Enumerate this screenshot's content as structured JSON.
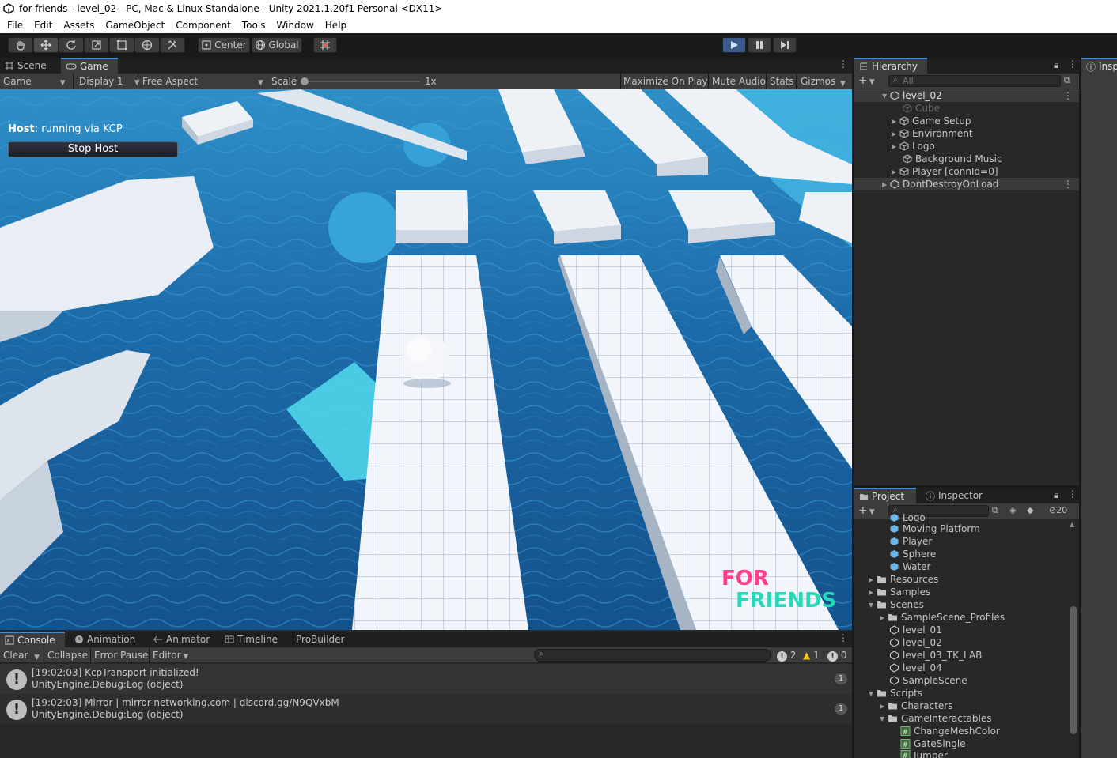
{
  "window": {
    "title": "for-friends - level_02 - PC, Mac & Linux Standalone - Unity 2021.1.20f1 Personal <DX11>"
  },
  "menu": [
    "File",
    "Edit",
    "Assets",
    "GameObject",
    "Component",
    "Tools",
    "Window",
    "Help"
  ],
  "toolbar": {
    "pivot_label": "Center",
    "space_label": "Global"
  },
  "game_panel": {
    "tabs": [
      "Scene",
      "Game"
    ],
    "mode": "Game",
    "display": "Display 1",
    "aspect": "Free Aspect",
    "scale_label": "Scale",
    "scale_value": "1x",
    "maximize_on_play": "Maximize On Play",
    "mute_audio": "Mute Audio",
    "stats": "Stats",
    "gizmos": "Gizmos",
    "host_label": "Host",
    "host_status": ": running via KCP",
    "stop_host": "Stop Host",
    "logo_line1": "FOR",
    "logo_line2": "FRIENDS"
  },
  "hierarchy": {
    "tab": "Hierarchy",
    "search_placeholder": "All",
    "items": [
      {
        "label": "level_02"
      },
      {
        "label": "Cube"
      },
      {
        "label": "Game Setup"
      },
      {
        "label": "Environment"
      },
      {
        "label": "Logo"
      },
      {
        "label": "Background Music"
      },
      {
        "label": "Player [connId=0]"
      },
      {
        "label": "DontDestroyOnLoad"
      }
    ]
  },
  "inspector_right_tab": "Insp",
  "project": {
    "tabs": [
      "Project",
      "Inspector"
    ],
    "hidden_count": "20",
    "items": [
      {
        "label": "Logo"
      },
      {
        "label": "Moving Platform"
      },
      {
        "label": "Player"
      },
      {
        "label": "Sphere"
      },
      {
        "label": "Water"
      },
      {
        "label": "Resources"
      },
      {
        "label": "Samples"
      },
      {
        "label": "Scenes"
      },
      {
        "label": "SampleScene_Profiles"
      },
      {
        "label": "level_01"
      },
      {
        "label": "level_02"
      },
      {
        "label": "level_03_TK_LAB"
      },
      {
        "label": "level_04"
      },
      {
        "label": "SampleScene"
      },
      {
        "label": "Scripts"
      },
      {
        "label": "Characters"
      },
      {
        "label": "GameInteractables"
      },
      {
        "label": "ChangeMeshColor"
      },
      {
        "label": "GateSingle"
      },
      {
        "label": "Jumper"
      }
    ]
  },
  "console": {
    "tabs": [
      "Console",
      "Animation",
      "Animator",
      "Timeline",
      "ProBuilder"
    ],
    "clear": "Clear",
    "collapse": "Collapse",
    "error_pause": "Error Pause",
    "editor": "Editor",
    "info_count": "2",
    "warn_count": "1",
    "error_count": "0",
    "logs": [
      {
        "line1": "[19:02:03] KcpTransport initialized!",
        "line2": "UnityEngine.Debug:Log (object)",
        "count": "1"
      },
      {
        "line1": "[19:02:03] Mirror | mirror-networking.com | discord.gg/N9QVxbM",
        "line2": "UnityEngine.Debug:Log (object)",
        "count": "1"
      }
    ]
  },
  "colors": {
    "water": "#1b5e98",
    "platform": "#e8eef5",
    "logo_pink": "#ff3f8a",
    "logo_teal": "#2ad8b8",
    "accent_blue": "#4a88d8"
  }
}
